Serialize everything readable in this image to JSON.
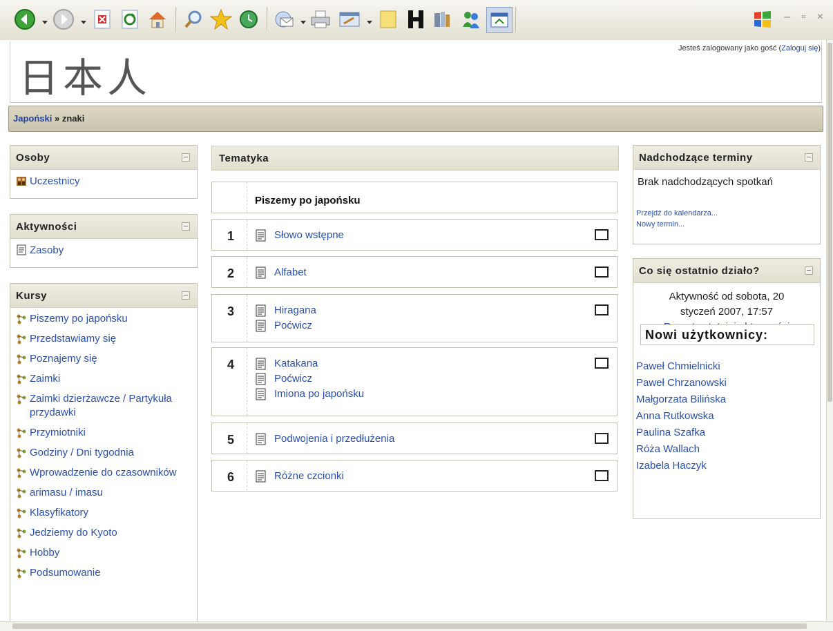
{
  "header": {
    "logo_text": "日本人",
    "login_prefix": "Jesteś zalogowany jako gość (",
    "login_link": "Zaloguj się",
    "login_suffix": ")"
  },
  "breadcrumb": {
    "course": "Japoński",
    "separator": " » ",
    "current": "znaki"
  },
  "blocks": {
    "osoby": {
      "title": "Osoby",
      "items": [
        "Uczestnicy"
      ]
    },
    "aktywnosci": {
      "title": "Aktywności",
      "items": [
        "Zasoby"
      ]
    },
    "kursy": {
      "title": "Kursy",
      "items": [
        "Piszemy po japońsku",
        "Przedstawiamy się",
        "Poznajemy się",
        "Zaimki",
        "Zaimki dzierżawcze / Partykuła przydawki",
        "Przymiotniki",
        "Godziny / Dni tygodnia",
        "Wprowadzenie do czasowników",
        "arimasu / imasu",
        "Klasyfikatory",
        "Jedziemy do Kyoto",
        "Hobby",
        "Podsumowanie"
      ]
    }
  },
  "topics": {
    "title": "Tematyka",
    "intro_title": "Piszemy po japońsku",
    "sections": [
      {
        "num": "1",
        "items": [
          "Słowo wstępne"
        ]
      },
      {
        "num": "2",
        "items": [
          "Alfabet"
        ]
      },
      {
        "num": "3",
        "items": [
          "Hiragana",
          "Poćwicz"
        ]
      },
      {
        "num": "4",
        "items": [
          "Katakana",
          "Poćwicz",
          "Imiona po japońsku"
        ]
      },
      {
        "num": "5",
        "items": [
          "Podwojenia i przedłużenia"
        ]
      },
      {
        "num": "6",
        "items": [
          "Różne czcionki"
        ]
      }
    ]
  },
  "upcoming": {
    "title": "Nadchodzące terminy",
    "empty": "Brak nadchodzących spotkań",
    "calendar_link": "Przejdź do kalendarza...",
    "new_event_link": "Nowy termin..."
  },
  "recent": {
    "title": "Co się ostatnio działo?",
    "activity_line1": "Aktywność od sobota, 20",
    "activity_line2": "styczeń 2007, 17:57",
    "report_link": "Raport ostatniej aktywności",
    "new_users_title": "Nowi użytkownicy:",
    "new_users": [
      "Paweł Chmielnicki",
      "Paweł Chrzanowski",
      "Małgorzata Bilińska",
      "Anna Rutkowska",
      "Paulina Szafka",
      "Róża Wallach",
      "Izabela Haczyk"
    ]
  },
  "colors": {
    "link": "#2a4fab",
    "navbar": "#cfcab3",
    "block_header": "#e8e6d9"
  }
}
